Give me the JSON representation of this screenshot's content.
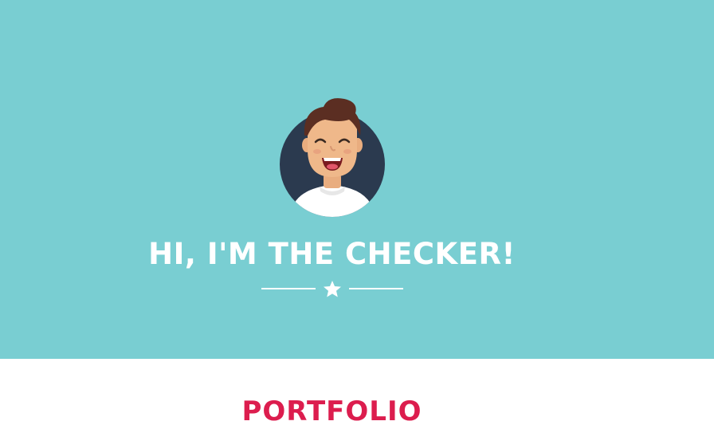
{
  "hero": {
    "headline": "HI, I'M THE CHECKER!",
    "avatar_icon": "smiling-person-avatar-icon",
    "divider_icon": "star-icon",
    "background_color": "#79ced2",
    "text_color": "#ffffff"
  },
  "portfolio": {
    "title": "PORTFOLIO",
    "title_color": "#dc1d4e"
  }
}
